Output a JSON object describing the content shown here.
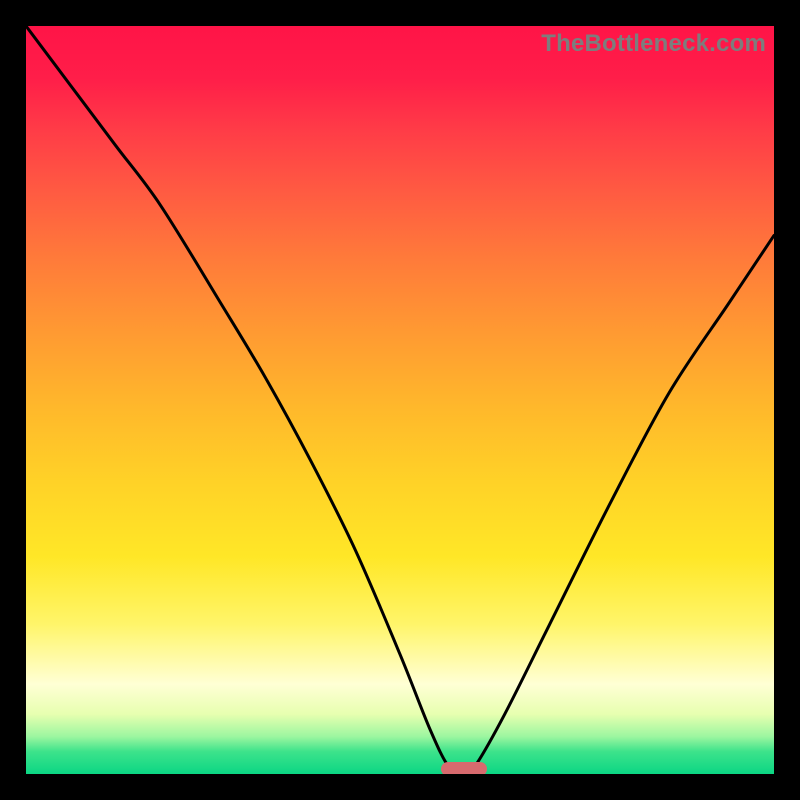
{
  "watermark": "TheBottleneck.com",
  "chart_data": {
    "type": "line",
    "title": "",
    "xlabel": "",
    "ylabel": "",
    "xlim": [
      0,
      100
    ],
    "ylim": [
      0,
      100
    ],
    "grid": false,
    "legend": false,
    "series": [
      {
        "name": "bottleneck-curve",
        "x": [
          0,
          6,
          12,
          18,
          26,
          32,
          38,
          44,
          50,
          54,
          56.5,
          58.5,
          60,
          64,
          70,
          78,
          86,
          94,
          100
        ],
        "values": [
          100,
          92,
          84,
          76,
          63,
          53,
          42,
          30,
          16,
          6,
          1,
          0,
          1,
          8,
          20,
          36,
          51,
          63,
          72
        ]
      }
    ],
    "marker": {
      "x": 58.5,
      "y": 0,
      "shape": "pill",
      "color": "#d76a6e"
    },
    "background_gradient": {
      "stops": [
        {
          "pos": 0.0,
          "color": "#ff1447"
        },
        {
          "pos": 0.5,
          "color": "#ffd227"
        },
        {
          "pos": 0.88,
          "color": "#ffffd5"
        },
        {
          "pos": 1.0,
          "color": "#0bd684"
        }
      ]
    }
  }
}
